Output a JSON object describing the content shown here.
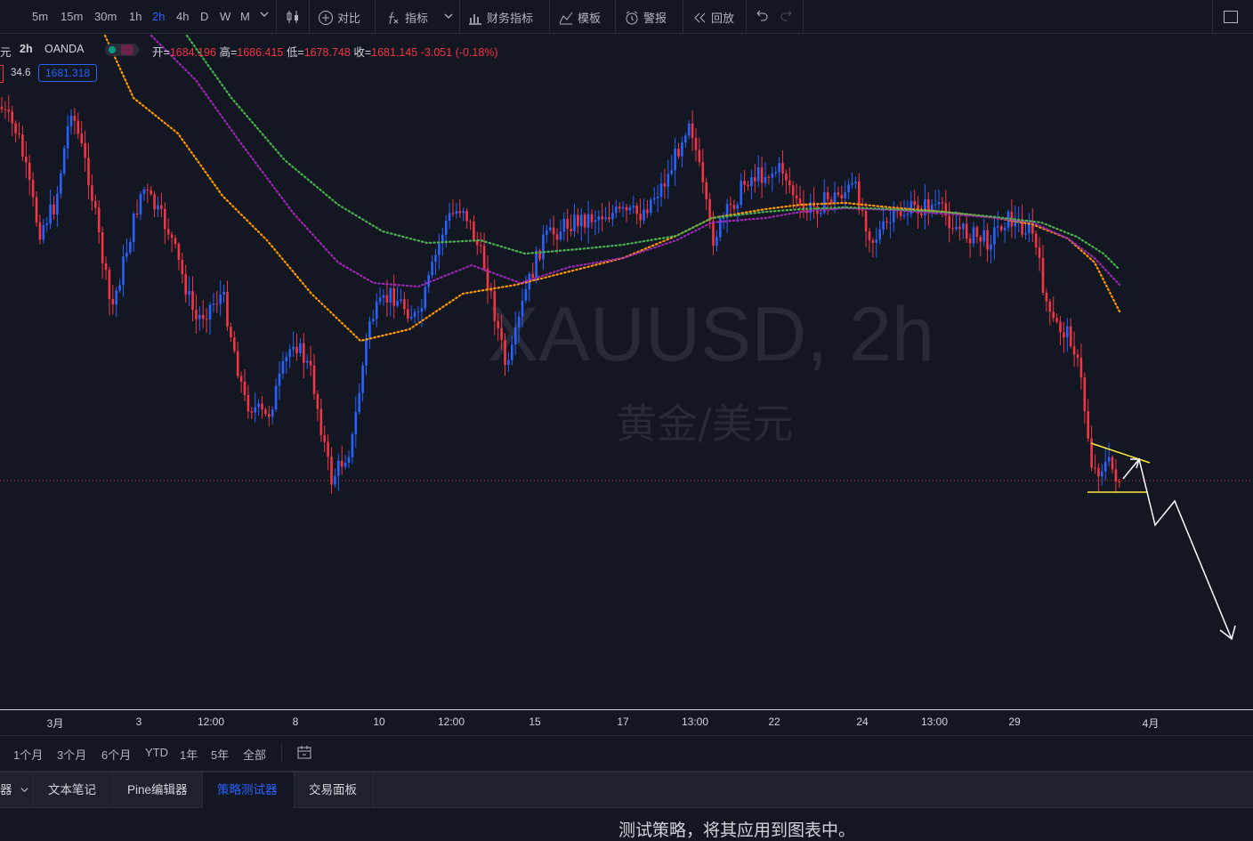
{
  "toolbar": {
    "timeframes": [
      "5m",
      "15m",
      "30m",
      "1h",
      "2h",
      "4h",
      "D",
      "W",
      "M"
    ],
    "active_timeframe": "2h",
    "compare_label": "对比",
    "indicators_label": "指标",
    "financials_label": "财务指标",
    "templates_label": "模板",
    "alerts_label": "警报",
    "replay_label": "回放"
  },
  "legend": {
    "prefix": "元",
    "interval": "2h",
    "source": "OANDA",
    "open_label": "开=",
    "open": "1684.196",
    "high_label": "高=",
    "high": "1686.415",
    "low_label": "低=",
    "low": "1678.748",
    "close_label": "收=",
    "close": "1681.145",
    "change": "-3.051 (-0.18%)",
    "indicator_value": "34.6",
    "price_badge": "1681.318"
  },
  "watermark": {
    "symbol": "XAUUSD, 2h",
    "description": "黄金/美元"
  },
  "xaxis": {
    "labels": [
      "3月",
      "3",
      "12:00",
      "8",
      "10",
      "12:00",
      "15",
      "17",
      "13:00",
      "22",
      "24",
      "13:00",
      "29",
      "4月"
    ]
  },
  "ranges": [
    "1个月",
    "3个月",
    "6个月",
    "YTD",
    "1年",
    "5年",
    "全部"
  ],
  "panel": {
    "tab_0": "器",
    "tab_notes": "文本笔记",
    "tab_pine": "Pine编辑器",
    "tab_strategy": "策略测试器",
    "tab_trading": "交易面板",
    "message": "测试策略，将其应用到图表中。"
  },
  "colors": {
    "bull": "#2962ff",
    "bear": "#f23645",
    "ma_fast": "#ff9800",
    "ma_mid": "#9c27b0",
    "ma_slow": "#4caf50",
    "drawing_pattern": "#ffeb3b",
    "drawing_arrow": "#ffffff"
  },
  "chart_data": {
    "type": "candlestick",
    "symbol": "XAUUSD",
    "interval": "2h",
    "x": [
      "3月",
      "3",
      "12:00",
      "8",
      "10",
      "12:00",
      "15",
      "17",
      "13:00",
      "22",
      "24",
      "13:00",
      "29",
      "4月"
    ],
    "closes_approx": [
      1725,
      1712,
      1695,
      1680,
      1700,
      1712,
      1710,
      1722,
      1735,
      1730,
      1725,
      1720,
      1708,
      1681
    ],
    "last_close": 1681.145
  }
}
